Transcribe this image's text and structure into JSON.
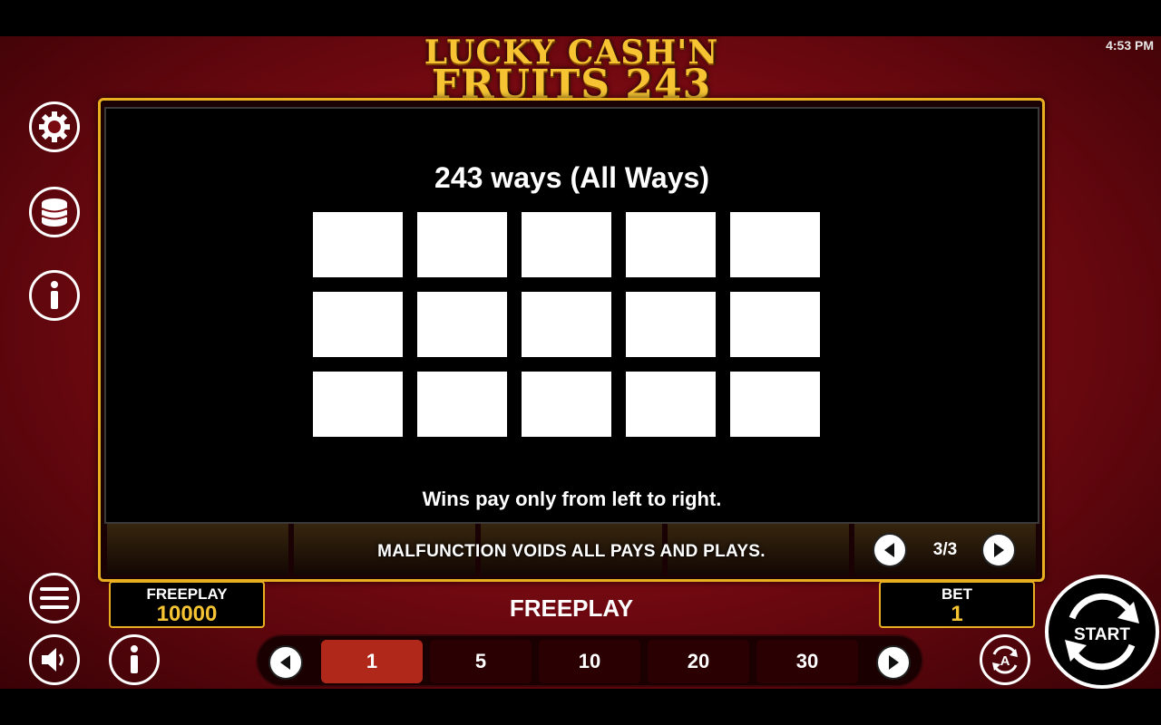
{
  "status_bar": {
    "time": "4:53 PM"
  },
  "logo": {
    "line1": "LUCKY CASH'N",
    "line2": "FRUITS 243"
  },
  "info_page": {
    "title": "243 ways (All Ways)",
    "grid": {
      "rows": 3,
      "columns": 5
    },
    "note": "Wins pay only from left to right."
  },
  "footer_notice": "MALFUNCTION VOIDS ALL PAYS AND PLAYS.",
  "pager": {
    "current": 3,
    "total": 3,
    "label": "3/3"
  },
  "side_menu": [
    "gear-icon",
    "coins-icon",
    "info-icon"
  ],
  "balance": {
    "label": "FREEPLAY",
    "value": "10000"
  },
  "mode": "FREEPLAY",
  "bet": {
    "label": "BET",
    "value": "1"
  },
  "bet_options": [
    {
      "label": "1",
      "selected": true
    },
    {
      "label": "5",
      "selected": false
    },
    {
      "label": "10",
      "selected": false
    },
    {
      "label": "20",
      "selected": false
    },
    {
      "label": "30",
      "selected": false
    }
  ],
  "start_button": {
    "label": "START"
  },
  "colors": {
    "gold": "#e8b021",
    "red_bg": "#7a0a12",
    "selected_bet": "#b0281a"
  }
}
